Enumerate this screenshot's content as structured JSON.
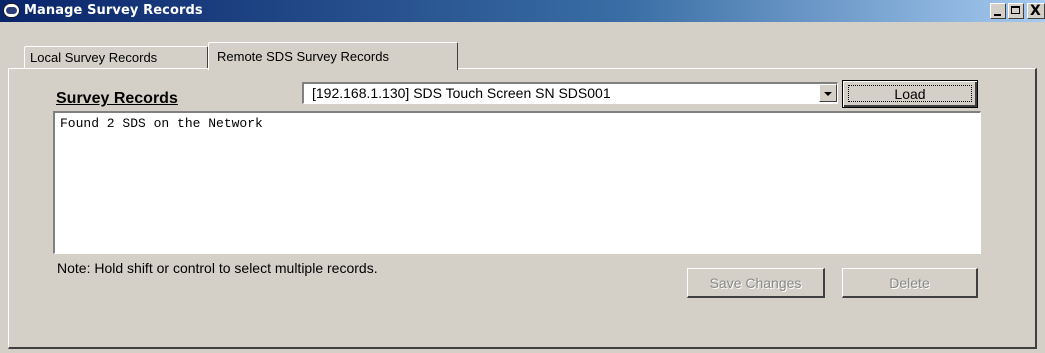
{
  "window": {
    "title": "Manage Survey Records",
    "app_icon": "sds-app-icon",
    "controls": {
      "minimize_icon": "minimize-icon",
      "maximize_icon": "maximize-icon",
      "close_icon": "close-icon",
      "close_glyph": "X"
    }
  },
  "tabs": [
    {
      "label": "Local Survey Records",
      "selected": false
    },
    {
      "label": "Remote SDS Survey Records",
      "selected": true
    }
  ],
  "panel": {
    "section_label": "Survey Records",
    "device_select": {
      "selected_value": "[192.168.1.130] SDS Touch Screen SN SDS001",
      "arrow_icon": "dropdown-arrow-icon"
    },
    "load_button": "Load",
    "records_text": "Found 2 SDS on the Network",
    "note": "Note: Hold shift or control to select multiple records.",
    "save_button": "Save Changes",
    "delete_button": "Delete"
  },
  "colors": {
    "titlebar_start": "#0a246a",
    "titlebar_end": "#a6caf0",
    "window_bg": "#d4d0c8",
    "disabled_text": "#8a8a8a"
  }
}
